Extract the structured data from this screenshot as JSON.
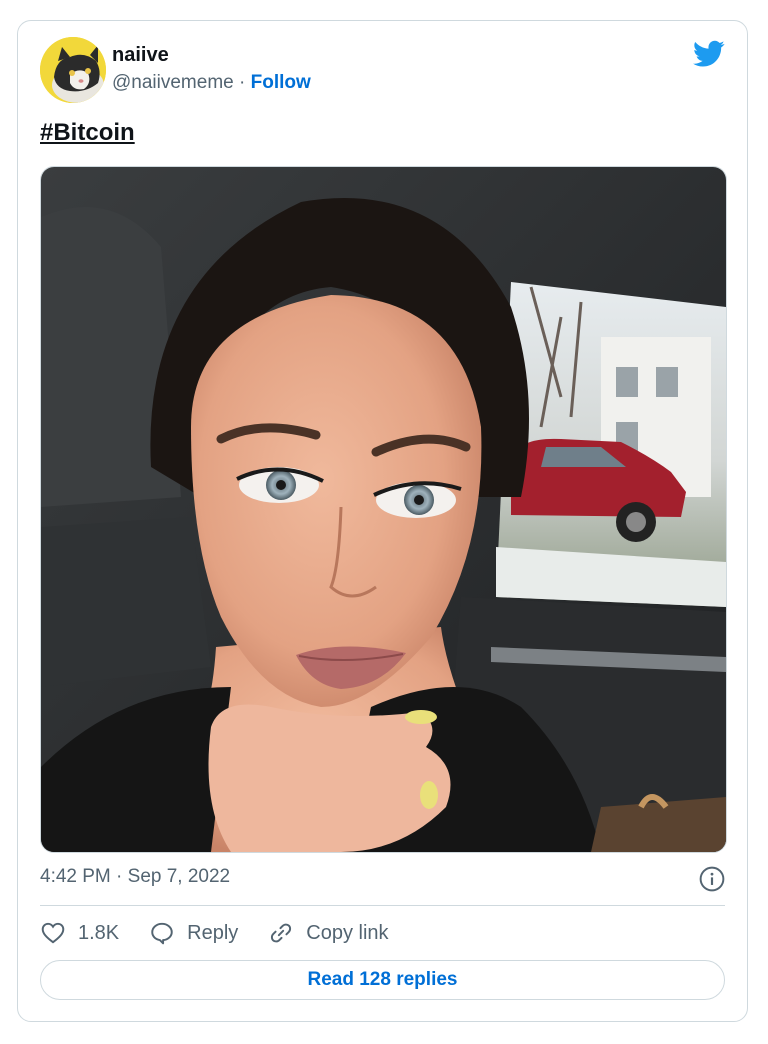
{
  "tweet": {
    "author": {
      "name": "naiive",
      "handle": "@naiivememe",
      "separator": "·",
      "follow_label": "Follow",
      "avatar_icon": "cat-avatar"
    },
    "platform_icon": "twitter-bird-icon",
    "text": "#Bitcoin",
    "timestamp": "4:42 PM · Sep 7, 2022",
    "actions": {
      "likes_count": "1.8K",
      "reply_label": "Reply",
      "copy_link_label": "Copy link"
    },
    "read_replies_label": "Read 128 replies"
  },
  "colors": {
    "accent": "#006fd6",
    "twitter_blue": "#1d9bf0",
    "secondary_text": "#536471",
    "border": "#cfd9de"
  }
}
